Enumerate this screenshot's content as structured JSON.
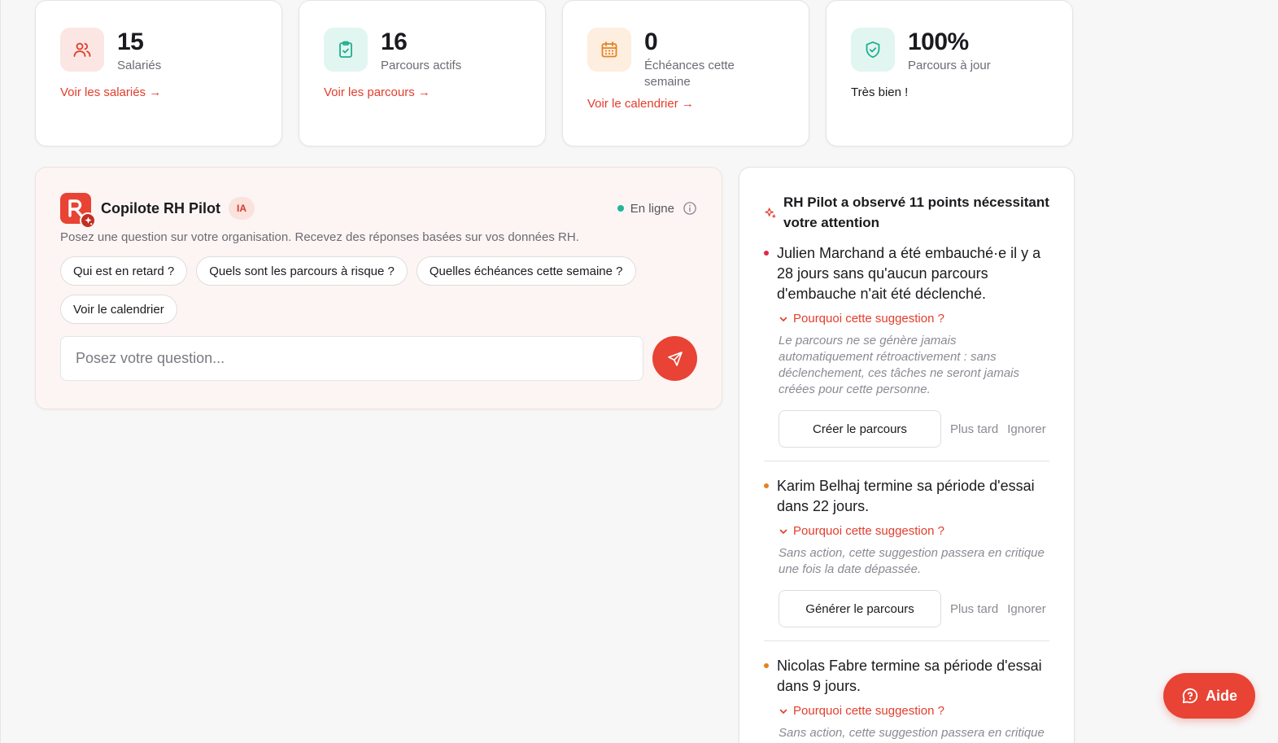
{
  "stats": [
    {
      "value": "15",
      "label": "Salariés",
      "link": "Voir les salariés →",
      "icon": "users-icon"
    },
    {
      "value": "16",
      "label": "Parcours actifs",
      "link": "Voir les parcours →",
      "icon": "clipboard-check-icon"
    },
    {
      "value": "0",
      "label": "Échéances cette semaine",
      "link": "Voir le calendrier →",
      "icon": "calendar-icon"
    },
    {
      "value": "100%",
      "label": "Parcours à jour",
      "note": "Très bien !",
      "icon": "shield-check-icon"
    }
  ],
  "copilot": {
    "title": "Copilote RH Pilot",
    "badge": "IA",
    "status": "En ligne",
    "subtitle": "Posez une question sur votre organisation. Recevez des réponses basées sur vos données RH.",
    "chips": [
      "Qui est en retard ?",
      "Quels sont les parcours à risque ?",
      "Quelles échéances cette semaine ?",
      "Voir le calendrier"
    ],
    "input_placeholder": "Posez votre question..."
  },
  "suggestions": {
    "title": "RH Pilot a observé 11 points nécessitant votre attention",
    "items": [
      {
        "message": "Julien Marchand a été embauché·e il y a 28 jours sans qu'aucun parcours d'embauche n'ait été déclenché.",
        "why": "Pourquoi cette suggestion ?",
        "reason": "Le parcours ne se génère jamais automatiquement rétroactivement : sans déclenchement, ces tâches ne seront jamais créées pour cette personne.",
        "action": "Créer le parcours",
        "later": "Plus tard",
        "ignore": "Ignorer",
        "color": "#e0284a"
      },
      {
        "message": "Karim Belhaj termine sa période d'essai dans 22 jours.",
        "why": "Pourquoi cette suggestion ?",
        "reason": "Sans action, cette suggestion passera en critique une fois la date dépassée.",
        "action": "Générer le parcours",
        "later": "Plus tard",
        "ignore": "Ignorer",
        "color": "#e5821f"
      },
      {
        "message": "Nicolas Fabre termine sa période d'essai dans 9 jours.",
        "why": "Pourquoi cette suggestion ?",
        "reason": "Sans action, cette suggestion passera en critique une fois la date dépassée.",
        "color": "#e5821f"
      }
    ]
  },
  "help": {
    "label": "Aide"
  },
  "colors": {
    "accent": "#e84334",
    "online": "#22b59a"
  }
}
